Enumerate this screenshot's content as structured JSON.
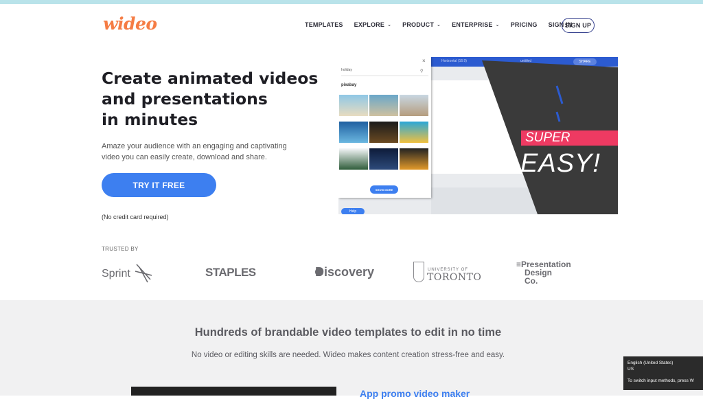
{
  "brand": {
    "logo_text": "wideo",
    "accent": "#f57c44",
    "primary": "#3d7ff0"
  },
  "nav": {
    "items": [
      {
        "label": "TEMPLATES",
        "has_dropdown": false
      },
      {
        "label": "EXPLORE",
        "has_dropdown": true
      },
      {
        "label": "PRODUCT",
        "has_dropdown": true
      },
      {
        "label": "ENTERPRISE",
        "has_dropdown": true
      },
      {
        "label": "PRICING",
        "has_dropdown": false
      },
      {
        "label": "SIGN IN",
        "has_dropdown": false
      }
    ],
    "signup_label": "SIGN UP",
    "dropdown_icon": "chevron-down-icon"
  },
  "hero": {
    "title_lines": [
      "Create animated videos",
      "and presentations",
      "in minutes"
    ],
    "subtitle_lines": [
      "Amaze your audience with an engaging and captivating",
      "video you can easily create, download and share."
    ],
    "cta_label": "TRY IT FREE",
    "note": "(No credit card required)"
  },
  "mockup": {
    "topbar_format": "Horizontal (16:9)",
    "topbar_title": "untitled",
    "share_label": "SHARE",
    "search_value": "holiday",
    "provider": "pixabay",
    "show_more_label": "SHOW MORE",
    "help_label": "Help",
    "overlay_word_1": "SUPER",
    "overlay_word_2": "EASY!",
    "overlay_color": "#ee3a62"
  },
  "trusted": {
    "label": "TRUSTED BY",
    "logos": {
      "sprint": "Sprint",
      "staples": "STAPLES",
      "discovery": "Discovery",
      "univ_line": "UNIVERSITY OF",
      "toronto": "TORONTO",
      "pdc_lines": [
        "≡Presentation",
        "Design",
        "Co."
      ]
    }
  },
  "templates_section": {
    "title": "Hundreds of brandable video templates to edit in no time",
    "subtitle": "No video or editing skills are needed. Wideo makes content creation stress-free and easy.",
    "first_template_title": "App promo video maker"
  },
  "os_tooltip": {
    "language": "English (United States)",
    "region": "US",
    "hint": "To switch input methods, press W"
  }
}
